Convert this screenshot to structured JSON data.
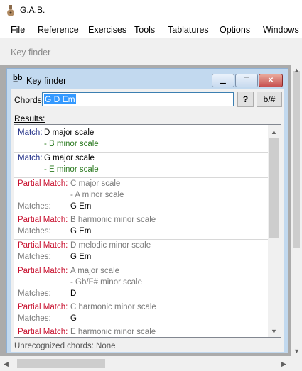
{
  "app": {
    "title": "G.A.B."
  },
  "menu": [
    "File",
    "Reference",
    "Exercises",
    "Tools",
    "Tablatures",
    "Options",
    "Windows"
  ],
  "toolbar": {
    "label": "Key finder"
  },
  "keyfinder": {
    "title": "Key finder",
    "chords_label": "Chords:",
    "chords_value": "G D Em",
    "help_button": "?",
    "flat_sharp_button": "b/#",
    "results_label": "Results:",
    "status": "Unrecognized chords: None",
    "window_buttons": {
      "minimize": "▁",
      "maximize": "☐",
      "close": "✕"
    }
  },
  "results": [
    {
      "prefix": "Match:",
      "scale": "D major scale",
      "relative": "- B minor scale"
    },
    {
      "prefix": "Match:",
      "scale": "G major scale",
      "relative": "- E minor scale"
    },
    {
      "prefix": "Partial Match:",
      "scale": "C major scale",
      "relative": "- A minor scale",
      "matches_label": "Matches:",
      "matches": "G Em"
    },
    {
      "prefix": "Partial Match:",
      "scale": "B harmonic minor scale",
      "matches_label": "Matches:",
      "matches": "G Em"
    },
    {
      "prefix": "Partial Match:",
      "scale": "D melodic minor scale",
      "matches_label": "Matches:",
      "matches": "G Em"
    },
    {
      "prefix": "Partial Match:",
      "scale": "A major scale",
      "relative": "- Gb/F# minor scale",
      "matches_label": "Matches:",
      "matches": "D"
    },
    {
      "prefix": "Partial Match:",
      "scale": "C harmonic minor scale",
      "matches_label": "Matches:",
      "matches": "G"
    },
    {
      "prefix": "Partial Match:",
      "scale": "E harmonic minor scale"
    }
  ],
  "icons": {
    "up": "▲",
    "down": "▼",
    "left": "◀",
    "right": "▶"
  },
  "colors": {
    "match": "#1f2d86",
    "partial": "#c8102e",
    "relative": "#2a7a1f"
  }
}
